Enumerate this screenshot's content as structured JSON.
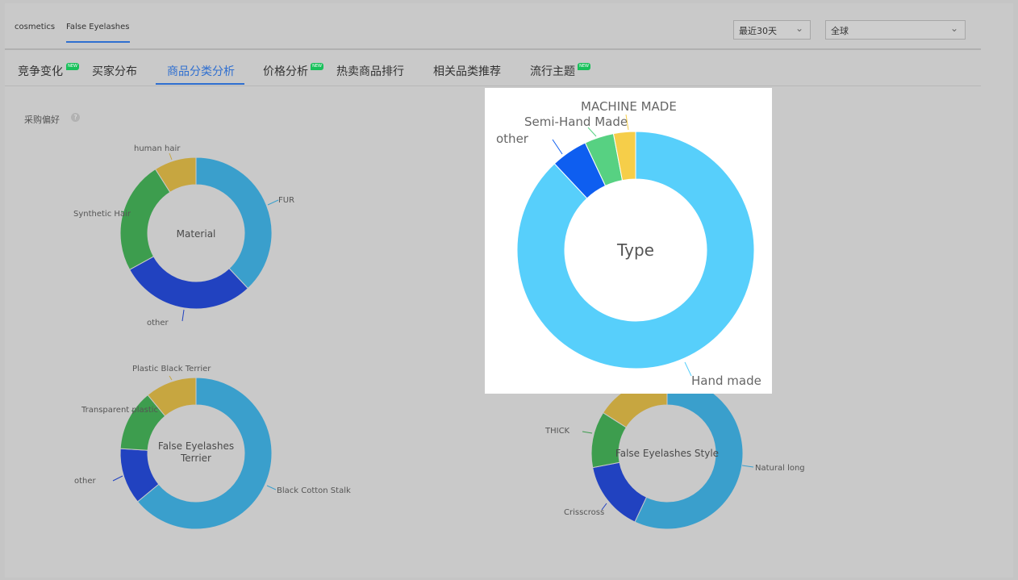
{
  "header": {
    "breadcrumbs": [
      {
        "label": "cosmetics",
        "active": false
      },
      {
        "label": "False Eyelashes",
        "active": true
      }
    ],
    "period_select": "最近30天",
    "region_select": "全球"
  },
  "tabs": [
    {
      "label": "竞争变化",
      "badge": "NEW",
      "active": false
    },
    {
      "label": "买家分布",
      "badge": "",
      "active": false
    },
    {
      "label": "商品分类分析",
      "badge": "",
      "active": true
    },
    {
      "label": "价格分析",
      "badge": "NEW",
      "active": false
    },
    {
      "label": "热卖商品排行",
      "badge": "",
      "active": false
    },
    {
      "label": "相关品类推荐",
      "badge": "",
      "active": false
    },
    {
      "label": "流行主题",
      "badge": "NEW",
      "active": false
    }
  ],
  "section": {
    "title": "采购偏好",
    "help_icon": "question-circle-icon"
  },
  "colors": {
    "blue_light": "#3a9fcc",
    "royal_blue": "#2142c0",
    "green": "#3d9d4e",
    "gold": "#c7a640",
    "popup_blue_light": "#57cffb",
    "popup_blue": "#0e5ef0",
    "popup_green": "#57d182",
    "popup_gold": "#f6ce49",
    "accent": "#2f6fd0",
    "badge_green": "#19c05b"
  },
  "chart_data": [
    {
      "type": "pie",
      "donut": true,
      "title": "Material",
      "categories": [
        "FUR",
        "other",
        "Synthetic Hair",
        "human hair"
      ],
      "values": [
        38,
        29,
        24,
        9
      ]
    },
    {
      "type": "pie",
      "donut": true,
      "title": "False Eyelashes Terrier",
      "categories": [
        "Black Cotton Stalk",
        "other",
        "Transparent plastic",
        "Plastic Black Terrier"
      ],
      "values": [
        64,
        12,
        13,
        11
      ]
    },
    {
      "type": "pie",
      "donut": true,
      "title": "Type",
      "categories": [
        "Hand made",
        "other",
        "Semi-Hand Made",
        "MACHINE MADE"
      ],
      "values": [
        88,
        5,
        4,
        3
      ]
    },
    {
      "type": "pie",
      "donut": true,
      "title": "False Eyelashes Style",
      "categories": [
        "Natural long",
        "Crisscross",
        "THICK",
        ""
      ],
      "values": [
        57,
        15,
        12,
        16
      ]
    }
  ]
}
